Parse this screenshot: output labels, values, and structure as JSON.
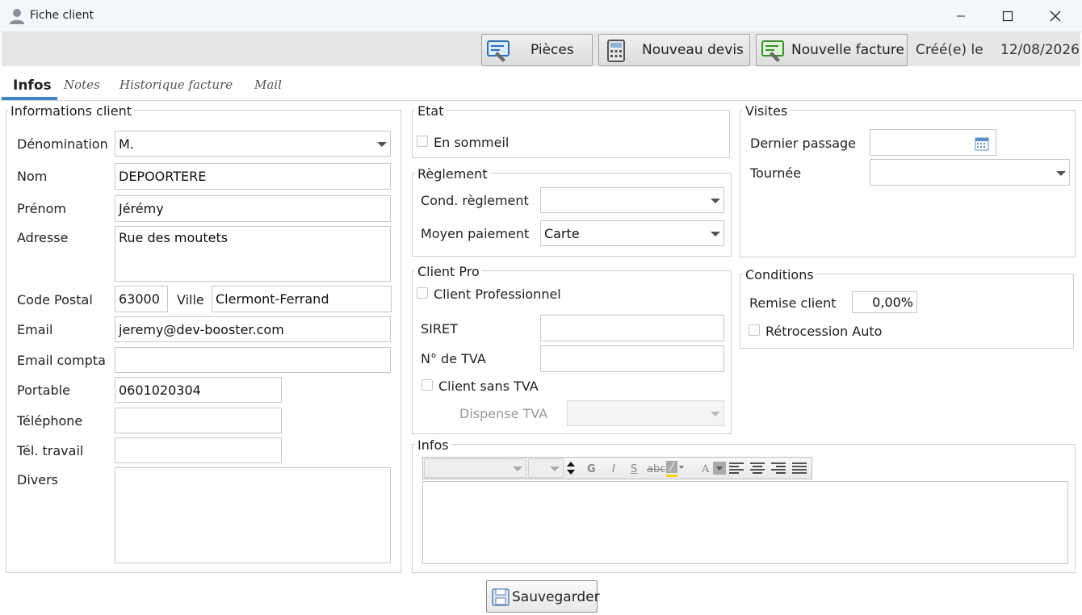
{
  "window": {
    "title": "Fiche client"
  },
  "toolbar": {
    "pieces_label": "Pièces",
    "new_quote_label": "Nouveau devis",
    "new_invoice_label": "Nouvelle facture",
    "created_label": "Créé(e) le",
    "created_date": "12/08/2026"
  },
  "tabs": {
    "infos": "Infos",
    "notes": "Notes",
    "history": "Historique facture",
    "mail": "Mail"
  },
  "client": {
    "title": "Informations client",
    "denomination_label": "Dénomination",
    "denomination_value": "M.",
    "nom_label": "Nom",
    "nom_value": "DEPOORTERE",
    "prenom_label": "Prénom",
    "prenom_value": "Jérémy",
    "adresse_label": "Adresse",
    "adresse_value": "Rue des moutets",
    "cp_label": "Code Postal",
    "cp_value": "63000",
    "ville_label": "Ville",
    "ville_value": "Clermont-Ferrand",
    "email_label": "Email",
    "email_value": "jeremy@dev-booster.com",
    "email_compta_label": "Email compta",
    "email_compta_value": "",
    "portable_label": "Portable",
    "portable_value": "0601020304",
    "telephone_label": "Téléphone",
    "telephone_value": "",
    "tel_travail_label": "Tél. travail",
    "tel_travail_value": "",
    "divers_label": "Divers",
    "divers_value": ""
  },
  "etat": {
    "title": "Etat",
    "sommeil_label": "En sommeil"
  },
  "reglement": {
    "title": "Règlement",
    "cond_label": "Cond. règlement",
    "cond_value": "",
    "moyen_label": "Moyen paiement",
    "moyen_value": "Carte"
  },
  "client_pro": {
    "title": "Client Pro",
    "pro_label": "Client Professionnel",
    "siret_label": "SIRET",
    "siret_value": "",
    "tva_label": "N° de TVA",
    "tva_value": "",
    "sans_tva_label": "Client sans TVA",
    "dispense_label": "Dispense TVA",
    "dispense_value": ""
  },
  "visites": {
    "title": "Visites",
    "dernier_label": "Dernier passage",
    "dernier_value": "",
    "tournee_label": "Tournée",
    "tournee_value": ""
  },
  "conditions": {
    "title": "Conditions",
    "remise_label": "Remise client",
    "remise_value": "0,00%",
    "retro_label": "Rétrocession Auto"
  },
  "infos": {
    "title": "Infos",
    "bold": "G",
    "italic": "I",
    "underline": "S",
    "strike": "abc",
    "font_color": "A",
    "content": ""
  },
  "footer": {
    "save_label": "Sauvegarder"
  }
}
